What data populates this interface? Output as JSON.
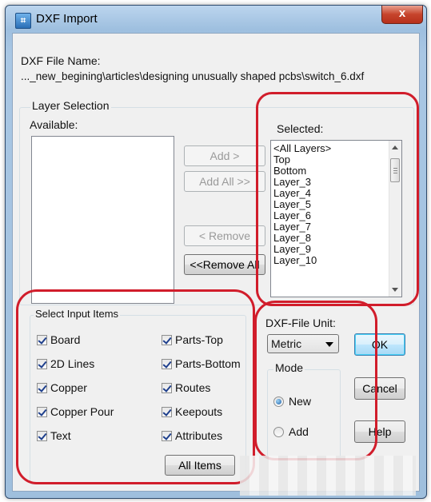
{
  "window": {
    "title": "DXF Import",
    "close_glyph": "x",
    "app_icon": "dxf-import-app-icon"
  },
  "file": {
    "label": "DXF File Name:",
    "path": "..._new_begining\\articles\\designing unusually shaped pcbs\\switch_6.dxf"
  },
  "layer_selection": {
    "group_label": "Layer Selection",
    "available_label": "Available:",
    "available_items": [],
    "selected_label": "Selected:",
    "selected_items": [
      "<All Layers>",
      "Top",
      "Bottom",
      "Layer_3",
      "Layer_4",
      "Layer_5",
      "Layer_6",
      "Layer_7",
      "Layer_8",
      "Layer_9",
      "Layer_10"
    ],
    "buttons": {
      "add": "Add >",
      "add_all": "Add All >>",
      "remove": "< Remove",
      "remove_all": "<<Remove All"
    }
  },
  "input_items": {
    "group_label": "Select Input Items",
    "left": [
      {
        "label": "Board",
        "checked": true
      },
      {
        "label": "2D Lines",
        "checked": true
      },
      {
        "label": "Copper",
        "checked": true
      },
      {
        "label": "Copper Pour",
        "checked": true
      },
      {
        "label": "Text",
        "checked": true
      }
    ],
    "right": [
      {
        "label": "Parts-Top",
        "checked": true
      },
      {
        "label": "Parts-Bottom",
        "checked": true
      },
      {
        "label": "Routes",
        "checked": true
      },
      {
        "label": "Keepouts",
        "checked": true
      },
      {
        "label": "Attributes",
        "checked": true
      }
    ],
    "all_items_button": "All  Items"
  },
  "unit": {
    "label": "DXF-File Unit:",
    "selected": "Metric"
  },
  "mode": {
    "group_label": "Mode",
    "options": [
      {
        "label": "New",
        "selected": true
      },
      {
        "label": "Add",
        "selected": false
      }
    ]
  },
  "actions": {
    "ok": "OK",
    "cancel": "Cancel",
    "help": "Help"
  },
  "colors": {
    "annotation_red": "#d11d2b",
    "titlebar_blue": "#a9c7e4",
    "dialog_bg": "#f0f0f0"
  }
}
